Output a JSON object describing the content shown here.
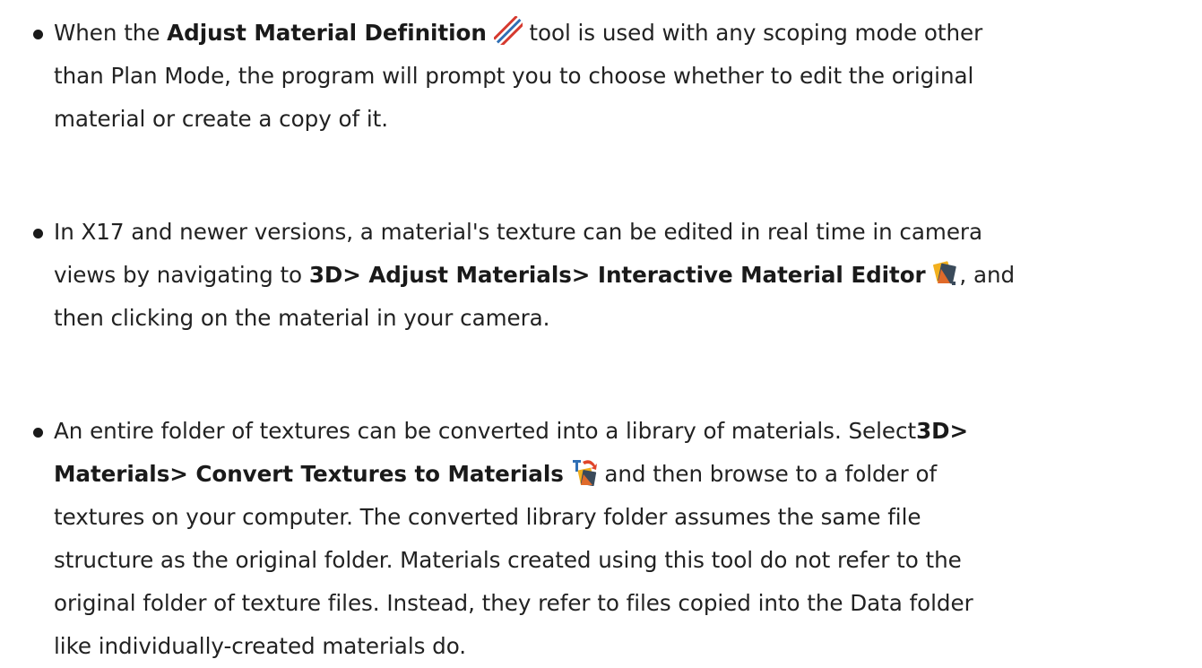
{
  "bullets": [
    {
      "lines": [
        {
          "pre": "When the ",
          "bold": "Adjust Material Definition",
          "icon": "adjust-material-definition-icon",
          "post": " tool is used with any scoping mode other"
        },
        {
          "text": "than Plan Mode, the program will prompt you to choose whether to edit the original"
        },
        {
          "text": "material or create a copy of it."
        }
      ]
    },
    {
      "lines": [
        {
          "text": "In X17 and newer versions, a material's texture can be edited in real time in camera"
        },
        {
          "pre": "views by navigating to ",
          "bold": "3D> Adjust Materials> Interactive Material Editor",
          "icon": "interactive-material-editor-icon",
          "post": ", and"
        },
        {
          "text": "then clicking on the material in your camera."
        }
      ]
    },
    {
      "lines": [
        {
          "pre": "An entire folder of textures can be converted into a library of materials. Select",
          "bold": "3D>"
        },
        {
          "bold": "Materials> Convert Textures to Materials",
          "icon": "convert-textures-to-materials-icon",
          "post": " and then browse to a folder of"
        },
        {
          "text": "textures on your computer. The converted library folder assumes the same file"
        },
        {
          "text": "structure as the original folder. Materials created using this tool do not refer to the"
        },
        {
          "text": "original folder of texture files. Instead, they refer to files copied into the Data folder"
        },
        {
          "text": "like individually-created materials do."
        }
      ]
    }
  ],
  "icon_colors": {
    "stripe_red": "#d63a2f",
    "stripe_blue": "#2f6fb5",
    "stripe_white": "#ffffff",
    "tile_yellow": "#f2b01e",
    "tile_dark": "#3a4a5a",
    "tile_orange": "#e06a2a",
    "letter_blue": "#2f6fb5",
    "arrow_red": "#e0452a"
  }
}
